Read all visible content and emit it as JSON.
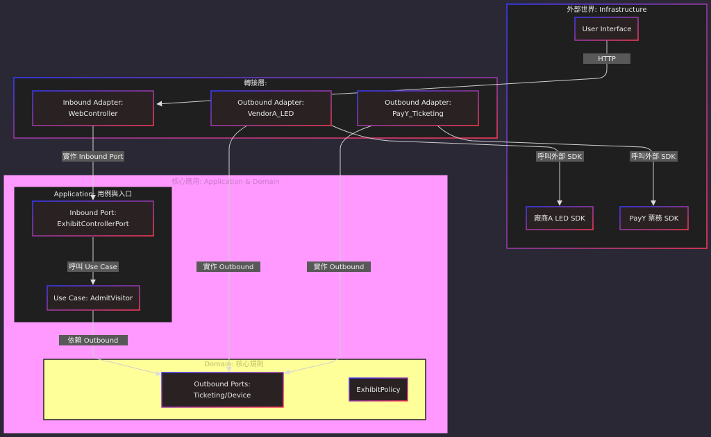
{
  "clusters": {
    "infra": {
      "label": "外部世界: Infrastructure"
    },
    "adapter": {
      "label": "轉接層:"
    },
    "core": {
      "label": "核心應用: Application & Domain"
    },
    "app": {
      "label": "Application: 用例與入口"
    },
    "domain": {
      "label": "Domain: 核心規則"
    }
  },
  "nodes": {
    "ui": {
      "label": "User Interface"
    },
    "inbound_adapter": {
      "line1": "Inbound Adapter:",
      "line2": "WebController"
    },
    "vendor_adapter": {
      "line1": "Outbound Adapter:",
      "line2": "VendorA_LED"
    },
    "payy_adapter": {
      "line1": "Outbound Adapter:",
      "line2": "PayY_Ticketing"
    },
    "vendor_sdk": {
      "label": "廠商A LED SDK"
    },
    "payy_sdk": {
      "label": "PayY 票務 SDK"
    },
    "inbound_port": {
      "line1": "Inbound Port:",
      "line2": "ExhibitControllerPort"
    },
    "use_case": {
      "label": "Use Case: AdmitVisitor"
    },
    "outbound_ports": {
      "line1": "Outbound Ports:",
      "line2": "Ticketing/Device"
    },
    "policy": {
      "label": "ExhibitPolicy"
    }
  },
  "edges": {
    "http": "HTTP",
    "implements_inbound": "實作 Inbound Port",
    "call_sdk_vendor": "呼叫外部 SDK",
    "call_sdk_payy": "呼叫外部 SDK",
    "call_use_case": "呼叫 Use Case",
    "implements_outbound_1": "實作 Outbound",
    "implements_outbound_2": "實作 Outbound",
    "depends_outbound": "依賴 Outbound"
  },
  "colors": {
    "background": "#2b2836",
    "node_fill": "#2a2222",
    "cluster_fill": "#1f1f1f",
    "core_fill": "#ff99ff",
    "domain_fill": "#ffff99",
    "border_blue": "#3a3aff",
    "border_red": "#ff3a5a"
  }
}
